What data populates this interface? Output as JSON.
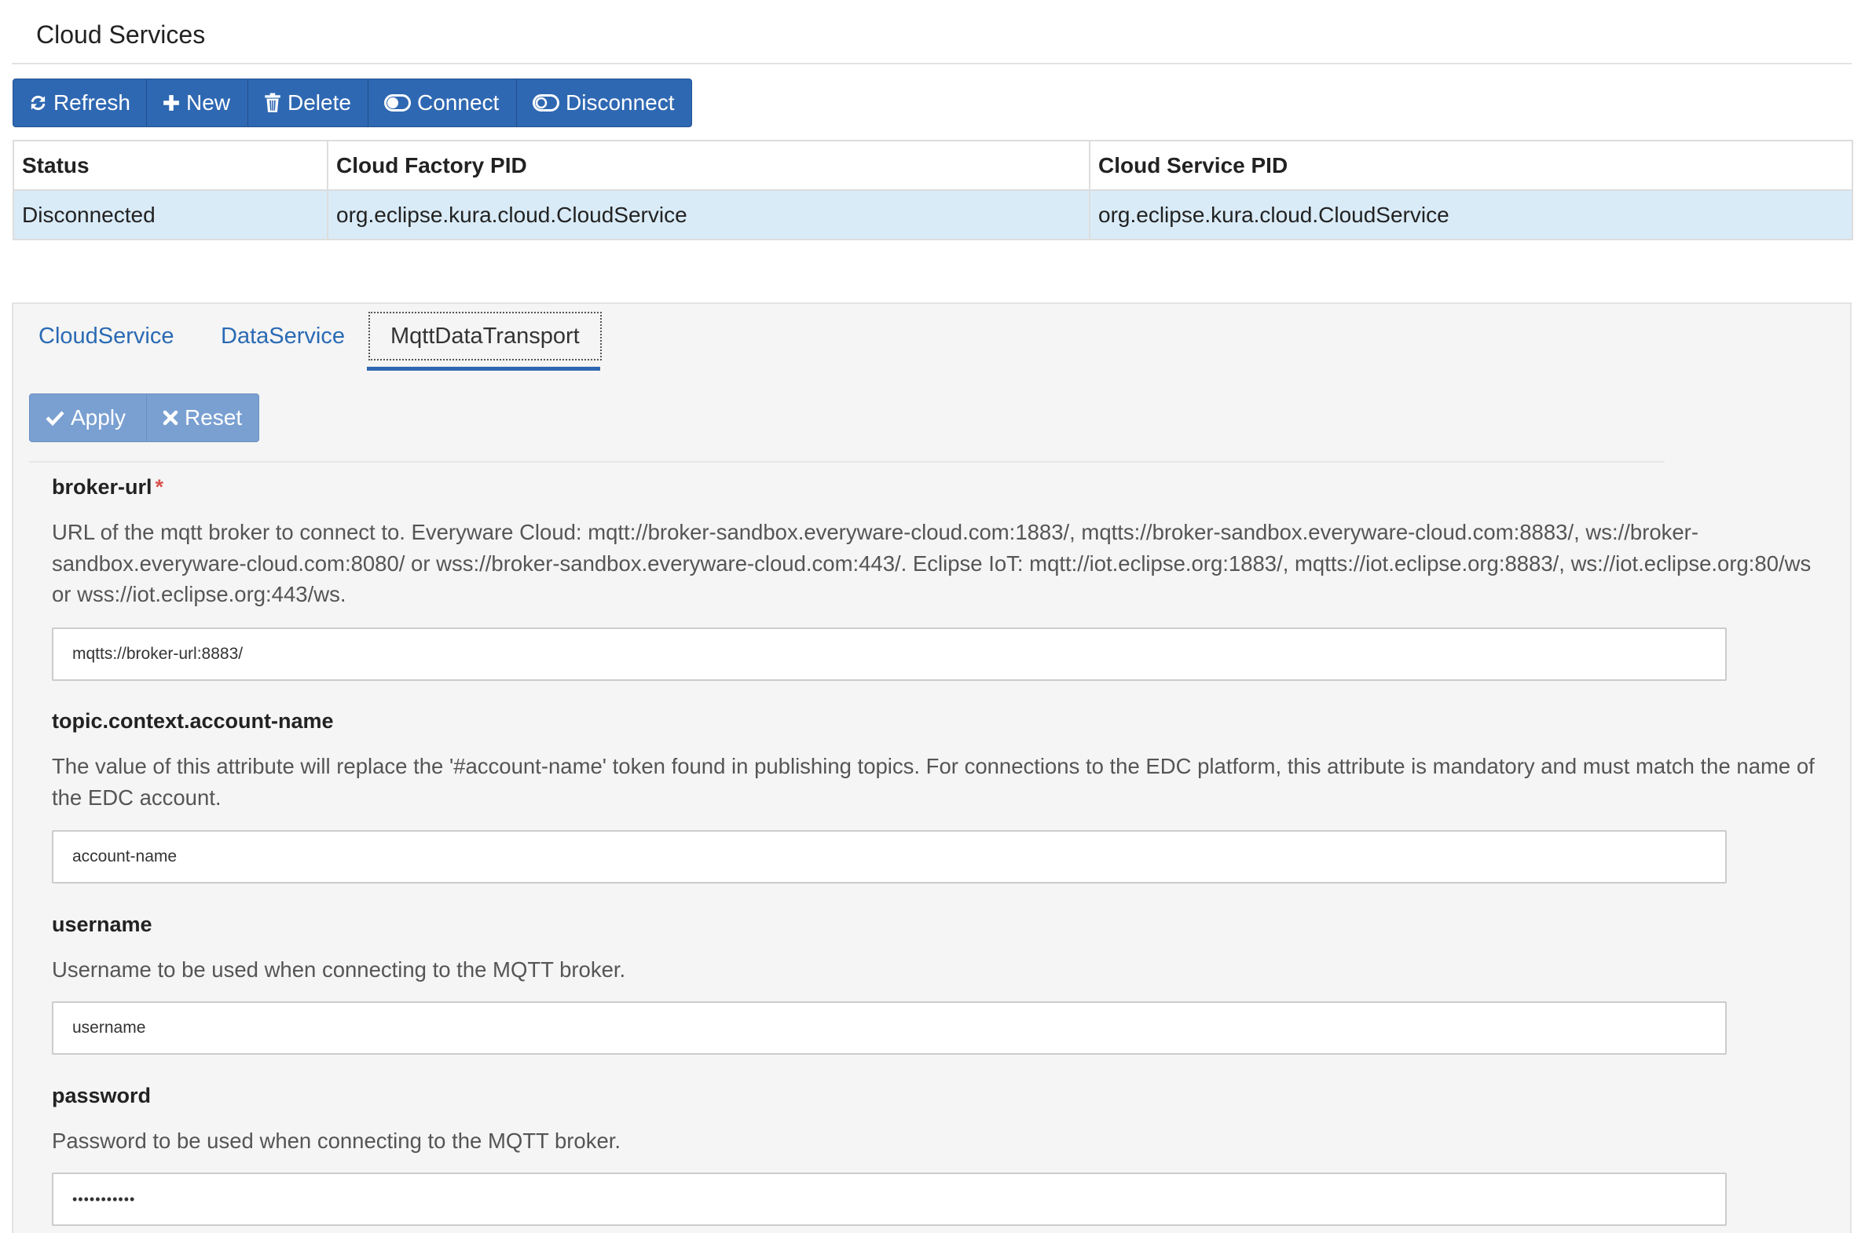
{
  "page": {
    "title": "Cloud Services"
  },
  "toolbar": {
    "refresh_label": "Refresh",
    "new_label": "New",
    "delete_label": "Delete",
    "connect_label": "Connect",
    "disconnect_label": "Disconnect"
  },
  "services_table": {
    "headers": [
      "Status",
      "Cloud Factory PID",
      "Cloud Service PID"
    ],
    "rows": [
      [
        "Disconnected",
        "org.eclipse.kura.cloud.CloudService",
        "org.eclipse.kura.cloud.CloudService"
      ]
    ]
  },
  "tabs": [
    {
      "label": "CloudService",
      "active": false
    },
    {
      "label": "DataService",
      "active": false
    },
    {
      "label": "MqttDataTransport",
      "active": true
    }
  ],
  "form_toolbar": {
    "apply_label": "Apply",
    "reset_label": "Reset"
  },
  "fields": [
    {
      "name": "broker-url",
      "required_marker": "*",
      "description": "URL of the mqtt broker to connect to. Everyware Cloud: mqtt://broker-sandbox.everyware-cloud.com:1883/, mqtts://broker-sandbox.everyware-cloud.com:8883/, ws://broker-sandbox.everyware-cloud.com:8080/ or wss://broker-sandbox.everyware-cloud.com:443/. Eclipse IoT: mqtt://iot.eclipse.org:1883/, mqtts://iot.eclipse.org:8883/, ws://iot.eclipse.org:80/ws or wss://iot.eclipse.org:443/ws.",
      "value": "mqtts://broker-url:8883/"
    },
    {
      "name": "topic.context.account-name",
      "description": "The value of this attribute will replace the '#account-name' token found in publishing topics. For connections to the EDC platform, this attribute is mandatory and must match the name of the EDC account.",
      "value": "account-name"
    },
    {
      "name": "username",
      "description": "Username to be used when connecting to the MQTT broker.",
      "value": "username"
    },
    {
      "name": "password",
      "description": "Password to be used when connecting to the MQTT broker.",
      "value": "•••••••••••"
    }
  ],
  "colors": {
    "primary_button": "#2f68b2",
    "disabled_button": "#7aa0d2",
    "selected_row": "#d9ebf7",
    "tab_link": "#2a6ab4",
    "required": "#d9534f"
  },
  "icons": {
    "refresh": "refresh-icon",
    "new": "plus-icon",
    "delete": "trash-icon",
    "connect": "toggle-on-icon",
    "disconnect": "toggle-off-icon",
    "apply": "check-icon",
    "reset": "x-icon"
  }
}
